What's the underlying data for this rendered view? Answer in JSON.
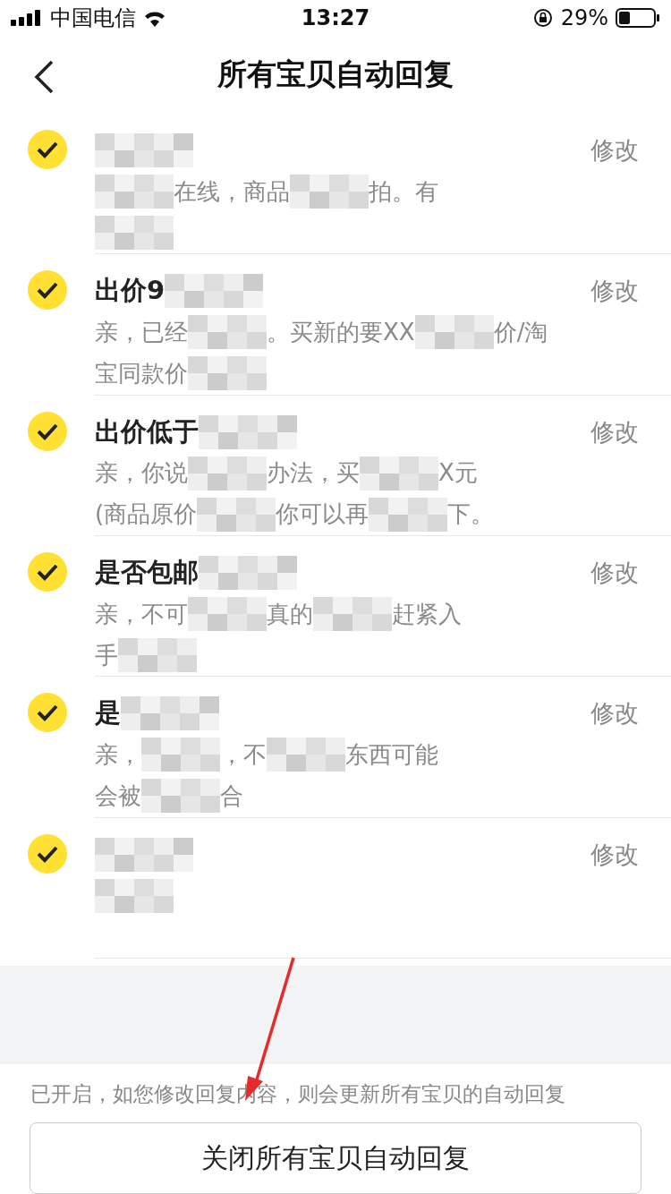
{
  "status_bar": {
    "carrier": "中国电信",
    "time": "13:27",
    "battery": "29%"
  },
  "nav": {
    "title": "所有宝贝自动回复"
  },
  "replies": [
    {
      "checked": true,
      "edit": "修改",
      "title": [
        {
          "kind": "mask"
        }
      ],
      "body": [
        [
          {
            "kind": "mask"
          },
          {
            "kind": "text",
            "text": "在线，商品"
          },
          {
            "kind": "mask"
          },
          {
            "kind": "text",
            "text": "拍。有"
          }
        ],
        [
          {
            "kind": "mask"
          }
        ]
      ]
    },
    {
      "checked": true,
      "edit": "修改",
      "title": [
        {
          "kind": "text",
          "text": "出价9"
        },
        {
          "kind": "mask"
        }
      ],
      "body": [
        [
          {
            "kind": "text",
            "text": "亲，已经"
          },
          {
            "kind": "mask"
          },
          {
            "kind": "text",
            "text": "。买新的要XX"
          },
          {
            "kind": "mask"
          },
          {
            "kind": "text",
            "text": "价/淘"
          }
        ],
        [
          {
            "kind": "text",
            "text": "宝同款价"
          },
          {
            "kind": "mask"
          }
        ]
      ]
    },
    {
      "checked": true,
      "edit": "修改",
      "title": [
        {
          "kind": "text",
          "text": "出价低于"
        },
        {
          "kind": "mask"
        }
      ],
      "body": [
        [
          {
            "kind": "text",
            "text": "亲，你说"
          },
          {
            "kind": "mask"
          },
          {
            "kind": "text",
            "text": "办法，买"
          },
          {
            "kind": "mask"
          },
          {
            "kind": "text",
            "text": "X元"
          }
        ],
        [
          {
            "kind": "text",
            "text": "(商品原价"
          },
          {
            "kind": "mask"
          },
          {
            "kind": "text",
            "text": "你可以再"
          },
          {
            "kind": "mask"
          },
          {
            "kind": "text",
            "text": "下。"
          }
        ]
      ]
    },
    {
      "checked": true,
      "edit": "修改",
      "title": [
        {
          "kind": "text",
          "text": "是否包邮"
        },
        {
          "kind": "mask"
        }
      ],
      "body": [
        [
          {
            "kind": "text",
            "text": "亲，不可"
          },
          {
            "kind": "mask"
          },
          {
            "kind": "text",
            "text": "真的"
          },
          {
            "kind": "mask"
          },
          {
            "kind": "text",
            "text": "赶紧入"
          }
        ],
        [
          {
            "kind": "text",
            "text": "手"
          },
          {
            "kind": "mask"
          }
        ]
      ]
    },
    {
      "checked": true,
      "edit": "修改",
      "title": [
        {
          "kind": "text",
          "text": "是"
        },
        {
          "kind": "mask"
        }
      ],
      "body": [
        [
          {
            "kind": "text",
            "text": "亲，"
          },
          {
            "kind": "mask"
          },
          {
            "kind": "text",
            "text": "，不"
          },
          {
            "kind": "mask"
          },
          {
            "kind": "text",
            "text": "东西可能"
          }
        ],
        [
          {
            "kind": "text",
            "text": "会被"
          },
          {
            "kind": "mask"
          },
          {
            "kind": "text",
            "text": "合"
          }
        ]
      ]
    },
    {
      "checked": true,
      "edit": "修改",
      "title": [
        {
          "kind": "mask"
        }
      ],
      "body": [
        [
          {
            "kind": "mask"
          }
        ]
      ]
    }
  ],
  "footer": {
    "note": "已开启，如您修改回复内容，则会更新所有宝贝的自动回复",
    "button": "关闭所有宝贝自动回复"
  },
  "annotation": {
    "kind": "arrow"
  }
}
